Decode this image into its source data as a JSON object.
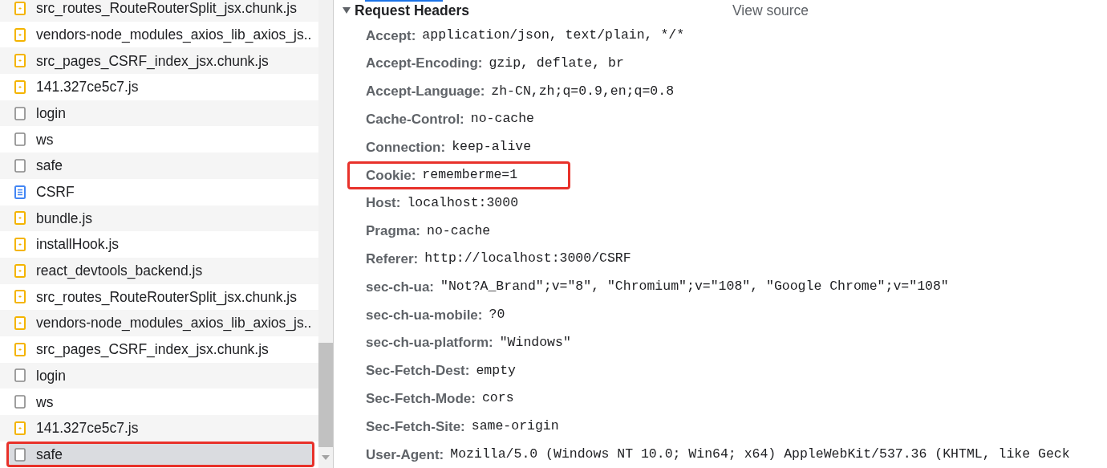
{
  "requests": [
    {
      "name": "src_routes_RouteRouterSplit_jsx.chunk.js",
      "kind": "script",
      "selected": false,
      "highlighted": false
    },
    {
      "name": "vendors-node_modules_axios_lib_axios_js..",
      "kind": "script",
      "selected": false,
      "highlighted": false
    },
    {
      "name": "src_pages_CSRF_index_jsx.chunk.js",
      "kind": "script",
      "selected": false,
      "highlighted": false
    },
    {
      "name": "141.327ce5c7.js",
      "kind": "script",
      "selected": false,
      "highlighted": false
    },
    {
      "name": "login",
      "kind": "other",
      "selected": false,
      "highlighted": false
    },
    {
      "name": "ws",
      "kind": "other",
      "selected": false,
      "highlighted": false
    },
    {
      "name": "safe",
      "kind": "other",
      "selected": false,
      "highlighted": false
    },
    {
      "name": "CSRF",
      "kind": "document",
      "selected": false,
      "highlighted": false
    },
    {
      "name": "bundle.js",
      "kind": "script",
      "selected": false,
      "highlighted": false
    },
    {
      "name": "installHook.js",
      "kind": "script",
      "selected": false,
      "highlighted": false
    },
    {
      "name": "react_devtools_backend.js",
      "kind": "script",
      "selected": false,
      "highlighted": false
    },
    {
      "name": "src_routes_RouteRouterSplit_jsx.chunk.js",
      "kind": "script",
      "selected": false,
      "highlighted": false
    },
    {
      "name": "vendors-node_modules_axios_lib_axios_js..",
      "kind": "script",
      "selected": false,
      "highlighted": false
    },
    {
      "name": "src_pages_CSRF_index_jsx.chunk.js",
      "kind": "script",
      "selected": false,
      "highlighted": false
    },
    {
      "name": "login",
      "kind": "other",
      "selected": false,
      "highlighted": false
    },
    {
      "name": "ws",
      "kind": "other",
      "selected": false,
      "highlighted": false
    },
    {
      "name": "141.327ce5c7.js",
      "kind": "script",
      "selected": false,
      "highlighted": false
    },
    {
      "name": "safe",
      "kind": "other",
      "selected": true,
      "highlighted": true
    }
  ],
  "request_headers": {
    "title": "Request Headers",
    "expanded": true,
    "view_source": "View source",
    "headers": [
      {
        "name": "Accept:",
        "value": "application/json, text/plain, */*",
        "highlighted": false
      },
      {
        "name": "Accept-Encoding:",
        "value": "gzip, deflate, br",
        "highlighted": false
      },
      {
        "name": "Accept-Language:",
        "value": "zh-CN,zh;q=0.9,en;q=0.8",
        "highlighted": false
      },
      {
        "name": "Cache-Control:",
        "value": "no-cache",
        "highlighted": false
      },
      {
        "name": "Connection:",
        "value": "keep-alive",
        "highlighted": false
      },
      {
        "name": "Cookie:",
        "value": "rememberme=1",
        "highlighted": true
      },
      {
        "name": "Host:",
        "value": "localhost:3000",
        "highlighted": false
      },
      {
        "name": "Pragma:",
        "value": "no-cache",
        "highlighted": false
      },
      {
        "name": "Referer:",
        "value": "http://localhost:3000/CSRF",
        "highlighted": false
      },
      {
        "name": "sec-ch-ua:",
        "value": "\"Not?A_Brand\";v=\"8\", \"Chromium\";v=\"108\", \"Google Chrome\";v=\"108\"",
        "highlighted": false
      },
      {
        "name": "sec-ch-ua-mobile:",
        "value": "?0",
        "highlighted": false
      },
      {
        "name": "sec-ch-ua-platform:",
        "value": "\"Windows\"",
        "highlighted": false
      },
      {
        "name": "Sec-Fetch-Dest:",
        "value": "empty",
        "highlighted": false
      },
      {
        "name": "Sec-Fetch-Mode:",
        "value": "cors",
        "highlighted": false
      },
      {
        "name": "Sec-Fetch-Site:",
        "value": "same-origin",
        "highlighted": false
      },
      {
        "name": "User-Agent:",
        "value": "Mozilla/5.0 (Windows NT 10.0; Win64; x64) AppleWebKit/537.36 (KHTML, like Geck",
        "highlighted": false
      }
    ]
  }
}
